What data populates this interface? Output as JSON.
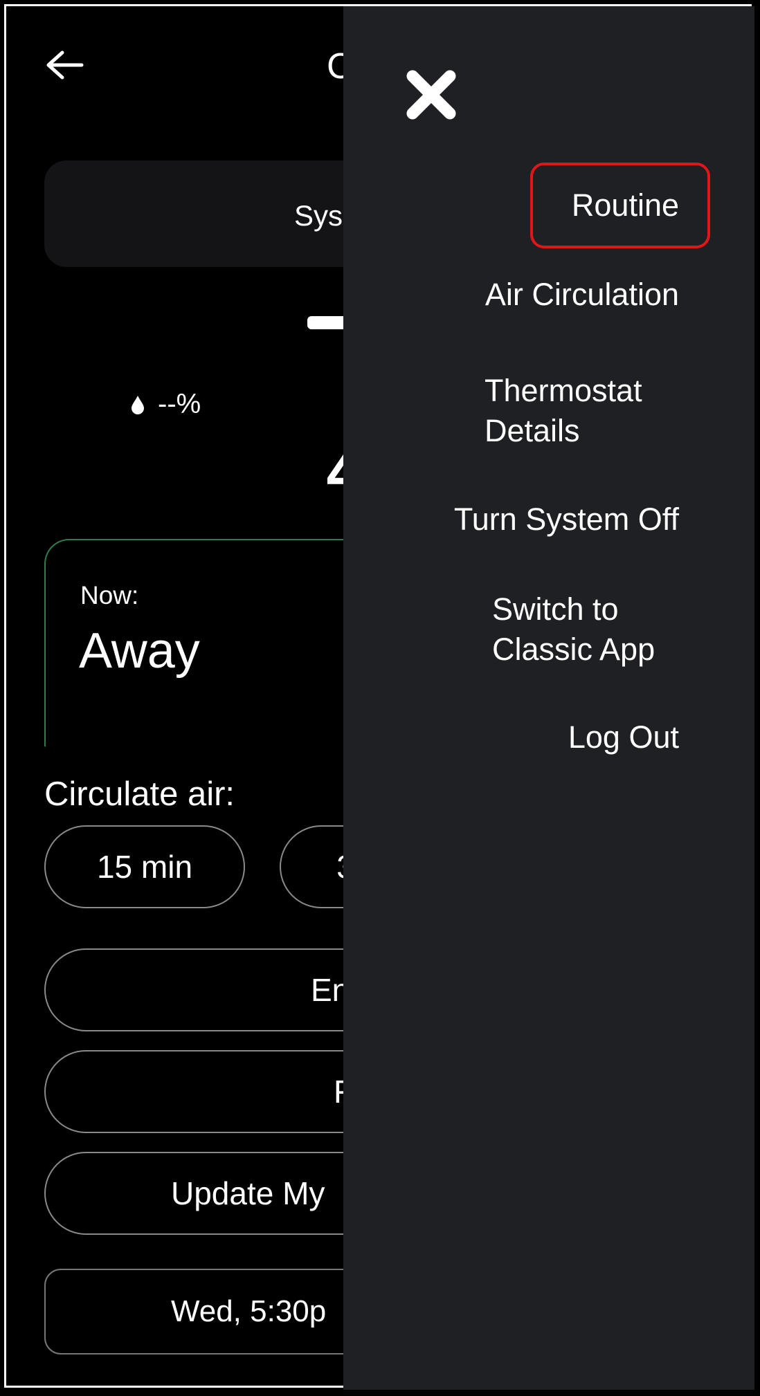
{
  "header": {
    "back_icon": "arrow-left-icon",
    "title_partial": "C"
  },
  "system_card": {
    "label_partial": "Sys"
  },
  "humidity": {
    "icon": "water-drop-icon",
    "value": "--%"
  },
  "temperature": {
    "partial": "4"
  },
  "now_card": {
    "label": "Now:",
    "value": "Away",
    "accent_color": "#2e7d4f"
  },
  "circulate": {
    "label": "Circulate air:",
    "options": [
      "15 min",
      "3"
    ]
  },
  "buttons": [
    "En",
    "F",
    "Update My"
  ],
  "schedule": {
    "text": "Wed, 5:30p"
  },
  "drawer": {
    "close_icon": "close-icon",
    "highlight_color": "#e0161b",
    "items": [
      {
        "label": "Routine"
      },
      {
        "label": "Air Circulation"
      },
      {
        "label": "Thermostat Details"
      },
      {
        "label": "Turn System Off"
      },
      {
        "label": "Switch to Classic App"
      },
      {
        "label": "Log Out"
      }
    ]
  }
}
